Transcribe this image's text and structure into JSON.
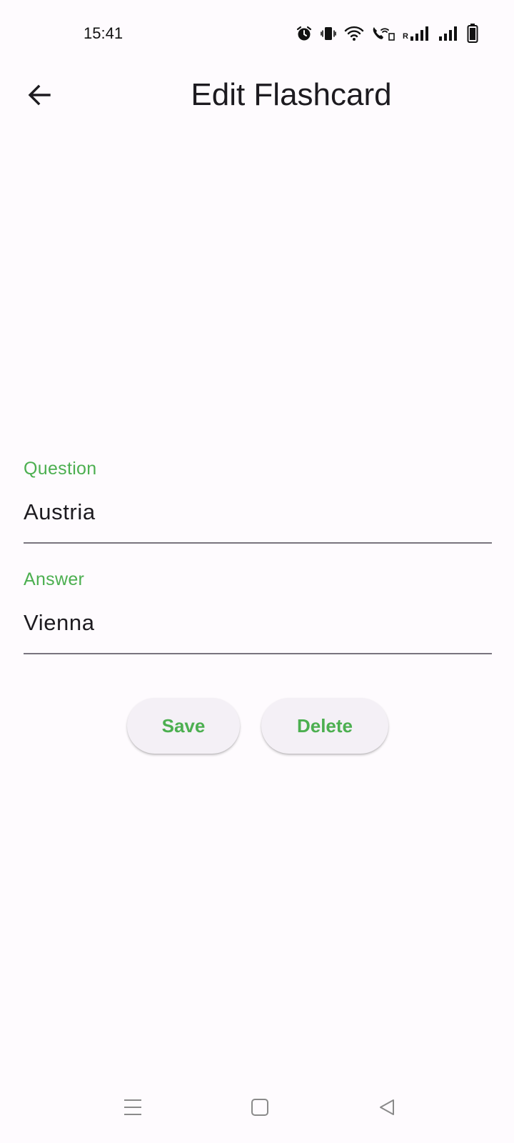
{
  "status_bar": {
    "time": "15:41",
    "icons": [
      "alarm-icon",
      "vibrate-icon",
      "wifi-icon",
      "wifi-calling-icon",
      "signal-roaming-icon",
      "signal-icon",
      "battery-icon"
    ],
    "roaming_label": "R"
  },
  "app_bar": {
    "title": "Edit Flashcard",
    "back_icon": "arrow-back-icon"
  },
  "form": {
    "question_label": "Question",
    "question_value": "Austria",
    "answer_label": "Answer",
    "answer_value": "Vienna"
  },
  "actions": {
    "save_label": "Save",
    "delete_label": "Delete"
  },
  "nav_bar": {
    "icons": [
      "menu-icon",
      "home-icon",
      "back-triangle-icon"
    ]
  },
  "colors": {
    "accent": "#4caf50",
    "background": "#fefbfe",
    "button_bg": "#f4f0f6",
    "underline": "#79747e",
    "text": "#1d1b20"
  }
}
